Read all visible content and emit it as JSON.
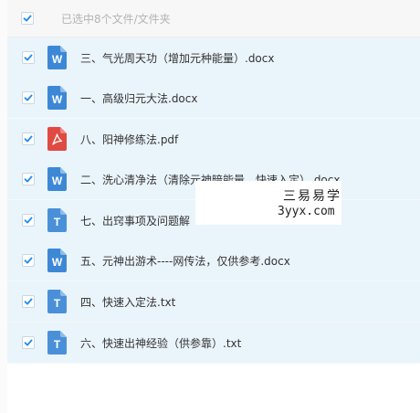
{
  "header": {
    "selection_label": "已选中8个文件/文件夹",
    "select_all_checked": true
  },
  "files": [
    {
      "name": "三、气光周天功（增加元种能量）.docx",
      "type": "word",
      "icon_letter": "W",
      "checked": true
    },
    {
      "name": "一、高级归元大法.docx",
      "type": "word",
      "icon_letter": "W",
      "checked": true
    },
    {
      "name": "八、阳神修练法.pdf",
      "type": "pdf",
      "icon_letter": "",
      "checked": true
    },
    {
      "name": "二、洗心清净法（清除元神暗能量，快速入定）.docx",
      "type": "word",
      "icon_letter": "W",
      "checked": true
    },
    {
      "name": "七、出窍事项及问题解",
      "type": "txt",
      "icon_letter": "T",
      "checked": true
    },
    {
      "name": "五、元神出游术----网传法，仅供参考.docx",
      "type": "word",
      "icon_letter": "W",
      "checked": true
    },
    {
      "name": "四、快速入定法.txt",
      "type": "txt",
      "icon_letter": "T",
      "checked": true
    },
    {
      "name": "六、快速出神经验（供参靠）.txt",
      "type": "txt",
      "icon_letter": "T",
      "checked": true
    }
  ],
  "watermark": {
    "title": "三易易学",
    "domain": "3yyx.com"
  },
  "colors": {
    "checkmark": "#1f8ceb",
    "row_selected": "#eaf4fb",
    "word_icon": "#3d88d6",
    "txt_icon": "#4a90d9",
    "pdf_icon": "#e04a42"
  }
}
